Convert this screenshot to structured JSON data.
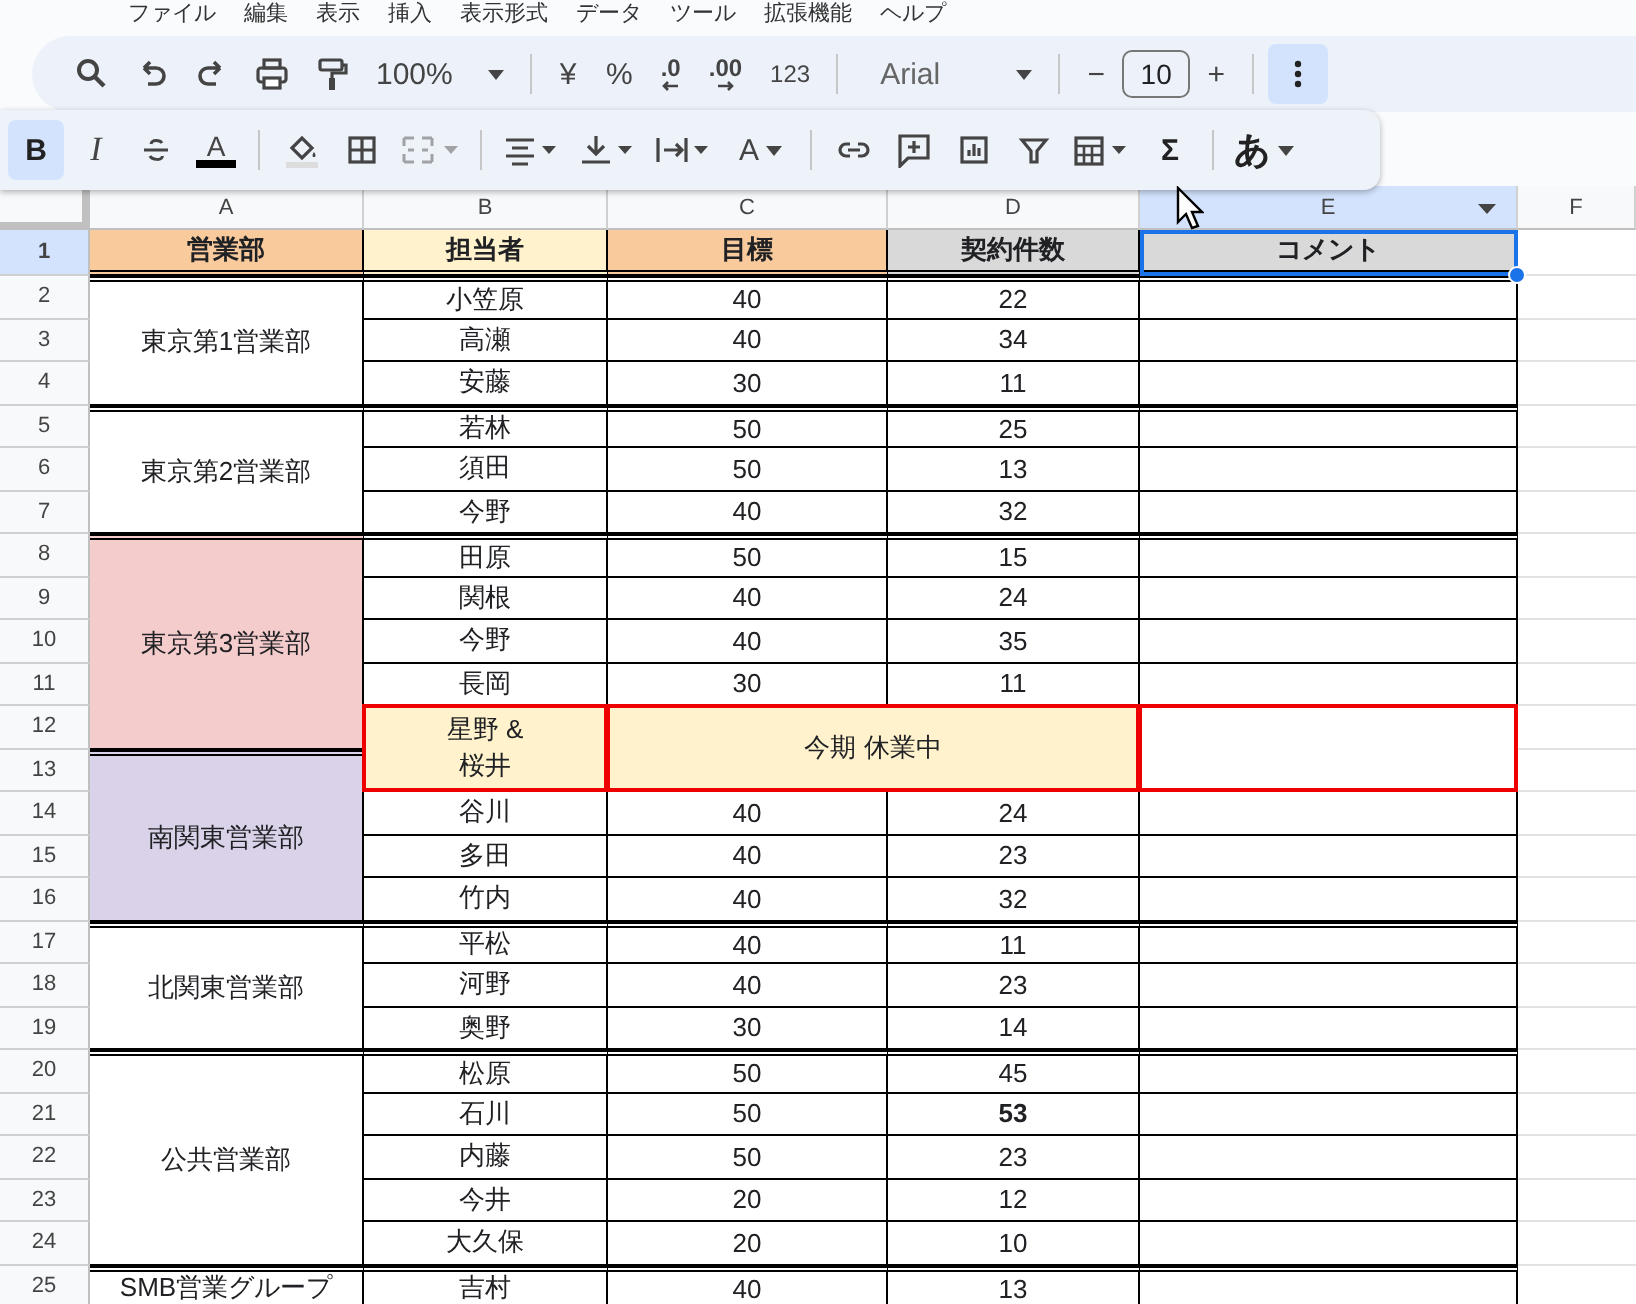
{
  "menu": [
    "ファイル",
    "編集",
    "表示",
    "挿入",
    "表示形式",
    "データ",
    "ツール",
    "拡張機能",
    "ヘルプ"
  ],
  "toolbar": [
    {
      "kind": "search"
    },
    {
      "kind": "undo"
    },
    {
      "kind": "redo"
    },
    {
      "kind": "print"
    },
    {
      "kind": "paint"
    },
    {
      "kind": "dropdown",
      "text": "100%"
    },
    {
      "kind": "sep"
    },
    {
      "kind": "text",
      "text": "¥"
    },
    {
      "kind": "text",
      "text": "%"
    },
    {
      "kind": "decdown",
      "text": ".0"
    },
    {
      "kind": "decup",
      "text": ".00"
    },
    {
      "kind": "small",
      "text": "123"
    },
    {
      "kind": "sep"
    },
    {
      "kind": "font",
      "text": "Arial"
    },
    {
      "kind": "sep"
    },
    {
      "kind": "text",
      "text": "−"
    },
    {
      "kind": "size",
      "text": "10"
    },
    {
      "kind": "text",
      "text": "+"
    },
    {
      "kind": "sep"
    },
    {
      "kind": "more",
      "selected": true
    }
  ],
  "format_bar": [
    {
      "kind": "glyph",
      "text": "B",
      "selected": true
    },
    {
      "kind": "italic",
      "text": "I",
      "selected": false
    },
    {
      "kind": "strike"
    },
    {
      "kind": "textcolor",
      "text": "A"
    },
    {
      "kind": "sep"
    },
    {
      "kind": "fill"
    },
    {
      "kind": "borders"
    },
    {
      "kind": "merge",
      "disabled": true
    },
    {
      "kind": "sep"
    },
    {
      "kind": "align"
    },
    {
      "kind": "valign"
    },
    {
      "kind": "wrap"
    },
    {
      "kind": "rotate",
      "text": "A"
    },
    {
      "kind": "sep"
    },
    {
      "kind": "link"
    },
    {
      "kind": "comment"
    },
    {
      "kind": "chart"
    },
    {
      "kind": "filter"
    },
    {
      "kind": "table"
    },
    {
      "kind": "glyph",
      "text": "Σ",
      "selected": false
    },
    {
      "kind": "sep"
    },
    {
      "kind": "ime",
      "text": "あ"
    }
  ],
  "columns": [
    {
      "letter": "A",
      "selected": false
    },
    {
      "letter": "B",
      "selected": false
    },
    {
      "letter": "C",
      "selected": false
    },
    {
      "letter": "D",
      "selected": false
    },
    {
      "letter": "E",
      "selected": true
    },
    {
      "letter": "F",
      "selected": false
    }
  ],
  "header_row": {
    "number": "1",
    "selected": true,
    "cells": [
      {
        "text": "営業部",
        "color": "#f9cb9c",
        "selected": false
      },
      {
        "text": "担当者",
        "color": "#fff2cc",
        "selected": false
      },
      {
        "text": "目標",
        "color": "#f9cb9c",
        "selected": false
      },
      {
        "text": "契約件数",
        "color": "#d9d9d9",
        "selected": false
      },
      {
        "text": "コメント",
        "color": "#d9d9d9",
        "selected": true
      }
    ]
  },
  "departments": [
    {
      "name": "東京第1営業部",
      "color": "#ffffff",
      "rows": [
        "2",
        "3",
        "4"
      ]
    },
    {
      "name": "東京第2営業部",
      "color": "#ffffff",
      "rows": [
        "5",
        "6",
        "7"
      ]
    },
    {
      "name": "東京第3営業部",
      "color": "#f4cccc",
      "rows": [
        "8",
        "9",
        "10",
        "11",
        "12"
      ]
    },
    {
      "name": "南関東営業部",
      "color": "#d9d2e9",
      "rows": [
        "13",
        "14",
        "15",
        "16"
      ]
    },
    {
      "name": "北関東営業部",
      "color": "#ffffff",
      "rows": [
        "17",
        "18",
        "19"
      ]
    },
    {
      "name": "公共営業部",
      "color": "#ffffff",
      "rows": [
        "20",
        "21",
        "22",
        "23",
        "24"
      ]
    },
    {
      "name": "SMB営業グループ",
      "color": "#ffffff",
      "rows": [
        "25"
      ]
    }
  ],
  "entries": [
    {
      "kind": "person",
      "person": "小笠原",
      "target": "40",
      "contracts": "22",
      "bold": false
    },
    {
      "kind": "person",
      "person": "高瀬",
      "target": "40",
      "contracts": "34",
      "bold": false
    },
    {
      "kind": "person",
      "person": "安藤",
      "target": "30",
      "contracts": "11",
      "bold": false
    },
    {
      "kind": "person",
      "person": "若林",
      "target": "50",
      "contracts": "25",
      "bold": false
    },
    {
      "kind": "person",
      "person": "須田",
      "target": "50",
      "contracts": "13",
      "bold": false
    },
    {
      "kind": "person",
      "person": "今野",
      "target": "40",
      "contracts": "32",
      "bold": false
    },
    {
      "kind": "person",
      "person": "田原",
      "target": "50",
      "contracts": "15",
      "bold": false
    },
    {
      "kind": "person",
      "person": "関根",
      "target": "40",
      "contracts": "24",
      "bold": false
    },
    {
      "kind": "person",
      "person": "今野",
      "target": "40",
      "contracts": "35",
      "bold": false
    },
    {
      "kind": "person",
      "person": "長岡",
      "target": "30",
      "contracts": "11",
      "bold": false
    },
    {
      "kind": "paused",
      "person": "星野 &\n桜井",
      "note": "今期 休業中"
    },
    {
      "kind": "person",
      "person": "谷川",
      "target": "40",
      "contracts": "24",
      "bold": false
    },
    {
      "kind": "person",
      "person": "多田",
      "target": "40",
      "contracts": "23",
      "bold": false
    },
    {
      "kind": "person",
      "person": "竹内",
      "target": "40",
      "contracts": "32",
      "bold": false
    },
    {
      "kind": "person",
      "person": "平松",
      "target": "40",
      "contracts": "11",
      "bold": false
    },
    {
      "kind": "person",
      "person": "河野",
      "target": "40",
      "contracts": "23",
      "bold": false
    },
    {
      "kind": "person",
      "person": "奥野",
      "target": "30",
      "contracts": "14",
      "bold": false
    },
    {
      "kind": "person",
      "person": "松原",
      "target": "50",
      "contracts": "45",
      "bold": false
    },
    {
      "kind": "person",
      "person": "石川",
      "target": "50",
      "contracts": "53",
      "bold": true
    },
    {
      "kind": "person",
      "person": "内藤",
      "target": "50",
      "contracts": "23",
      "bold": false
    },
    {
      "kind": "person",
      "person": "今井",
      "target": "20",
      "contracts": "12",
      "bold": false
    },
    {
      "kind": "person",
      "person": "大久保",
      "target": "20",
      "contracts": "10",
      "bold": false
    },
    {
      "kind": "person",
      "person": "吉村",
      "target": "40",
      "contracts": "13",
      "bold": false
    }
  ]
}
